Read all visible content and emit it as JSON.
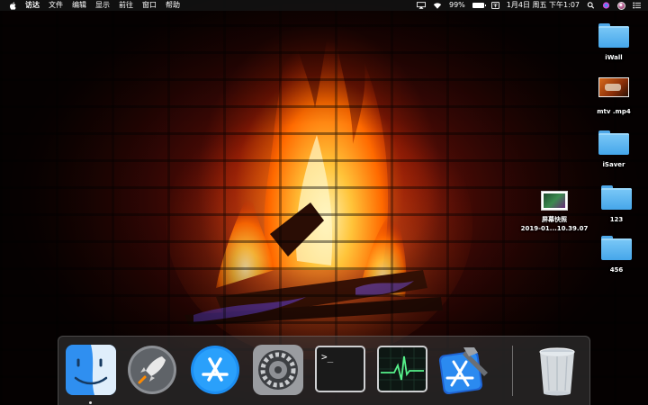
{
  "menubar": {
    "app_name": "访达",
    "menus": [
      "文件",
      "编辑",
      "显示",
      "前往",
      "窗口",
      "帮助"
    ],
    "battery_percent": "99%",
    "battery_level": 0.99,
    "datetime": "1月4日 周五 下午1:07",
    "icons": [
      "apple-icon",
      "airplay-icon",
      "wifi-icon",
      "battery-icon",
      "input-method-icon",
      "search-icon",
      "siri-icon",
      "user-avatar-icon",
      "notification-center-icon"
    ]
  },
  "desktop": {
    "icons": [
      {
        "label": "iWall",
        "type": "folder"
      },
      {
        "label": "mtv .mp4",
        "type": "video"
      },
      {
        "label": "iSaver",
        "type": "folder"
      },
      {
        "label": "123",
        "type": "folder"
      },
      {
        "label": "456",
        "type": "folder"
      },
      {
        "label_line1": "屏幕快照",
        "label_line2": "2019-01...10.39.07",
        "type": "screenshot"
      }
    ]
  },
  "dock": {
    "apps": [
      "finder-icon",
      "launchpad-icon",
      "app-store-icon",
      "system-preferences-icon",
      "terminal-icon",
      "activity-monitor-icon",
      "xcode-icon",
      "trash-icon"
    ],
    "terminal_prompt": ">_"
  },
  "colors": {
    "folder_blue": "#5bb5f2",
    "menubar_bg": "#141414",
    "dock_bg": "#3c3c3c"
  }
}
